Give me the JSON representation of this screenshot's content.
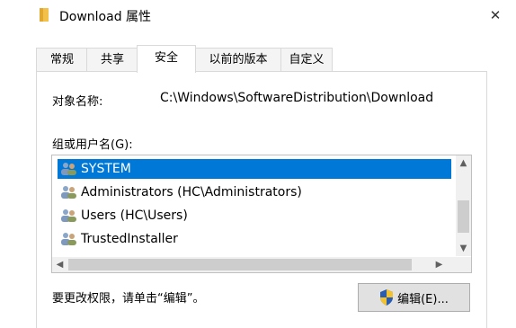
{
  "window": {
    "title": "Download 属性",
    "close_glyph": "✕"
  },
  "tabs": [
    {
      "label": "常规"
    },
    {
      "label": "共享"
    },
    {
      "label": "安全"
    },
    {
      "label": "以前的版本"
    },
    {
      "label": "自定义"
    }
  ],
  "active_tab": "安全",
  "object": {
    "label": "对象名称:",
    "value": "C:\\Windows\\SoftwareDistribution\\Download"
  },
  "groups": {
    "label": "组或用户名(G):",
    "items": [
      {
        "name": "SYSTEM",
        "selected": true
      },
      {
        "name": "Administrators (HC\\Administrators)",
        "selected": false
      },
      {
        "name": "Users (HC\\Users)",
        "selected": false
      },
      {
        "name": "TrustedInstaller",
        "selected": false
      }
    ]
  },
  "hint": "要更改权限，请单击“编辑”。",
  "edit_button": {
    "label": "编辑(E)..."
  },
  "colors": {
    "accent": "#0078d7",
    "folder": "#f3c04a"
  },
  "icons": {
    "title": "folder-icon",
    "user": "users-icon",
    "edit": "shield-icon"
  }
}
